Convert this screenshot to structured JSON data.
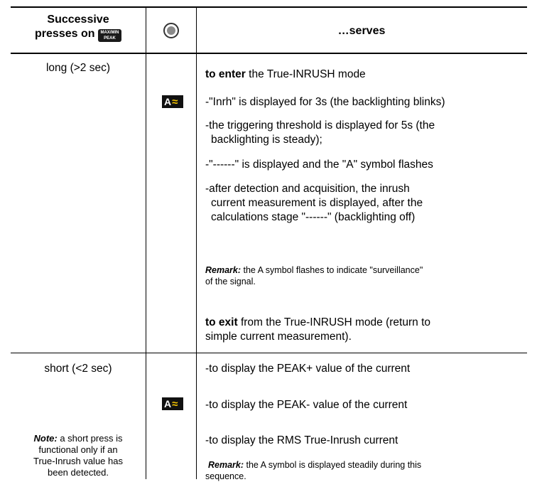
{
  "header": {
    "col1_line1": "Successive",
    "col1_line2": "presses on",
    "key_top": "MAX/MIN",
    "key_bottom": "PEAK",
    "col3": "…serves"
  },
  "icons": {
    "selector": "dial-icon",
    "mode": "A-tilde-icon",
    "mode_letter": "A",
    "mode_wave": "≈"
  },
  "row1": {
    "press": "long (>2 sec)",
    "enter_bold": "to enter",
    "enter_rest": " the True-INRUSH mode",
    "steps": [
      "-\"Inrh\" is displayed for 3s (the backlighting blinks)",
      "-the triggering threshold is displayed for 5s (the",
      "backlighting is steady);",
      "-\"------\" is displayed and the \"A\" symbol flashes",
      "-after detection and acquisition, the inrush",
      "current measurement is displayed, after the",
      "calculations stage \"------\" (backlighting off)"
    ],
    "remark_label": "Remark:",
    "remark_text_1": " the A symbol flashes to indicate \"surveillance\"",
    "remark_text_2": "of the signal.",
    "exit_bold": "to exit",
    "exit_rest_1": " from the True-INRUSH mode (return to",
    "exit_rest_2": "simple current measurement)."
  },
  "row2": {
    "press": "short (<2 sec)",
    "note_label": "Note:",
    "note_lines": [
      " a short press is",
      "functional only if an",
      "True-Inrush value has",
      "been detected."
    ],
    "items": [
      "-to display the PEAK+ value of the current",
      "-to display the PEAK- value of the current",
      "-to display the RMS True-Inrush current"
    ],
    "remark_label": "Remark:",
    "remark_text_1": " the A symbol is displayed steadily during this",
    "remark_text_2": "sequence."
  }
}
